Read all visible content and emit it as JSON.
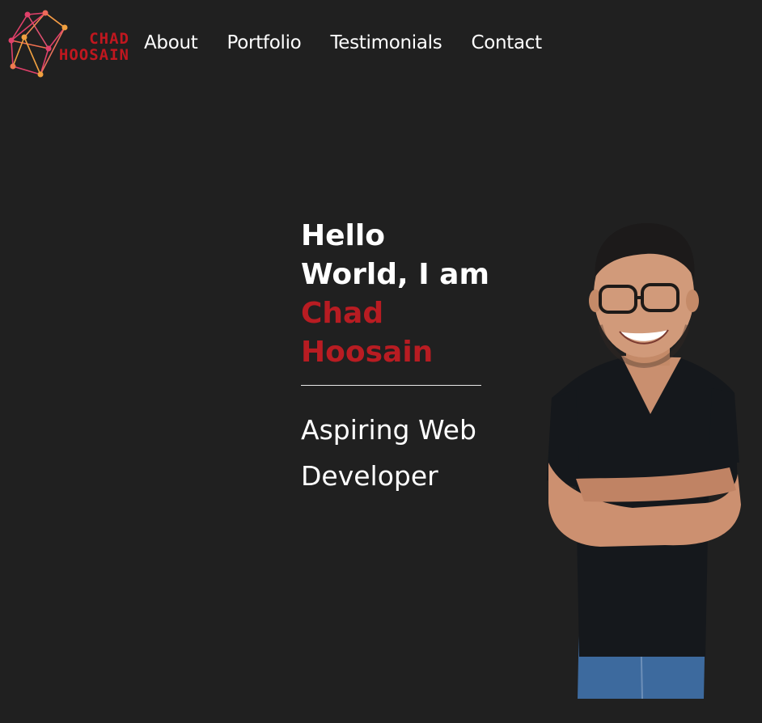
{
  "logo": {
    "line1": "CHAD",
    "line2": "HOOSAIN",
    "colors": {
      "text": "#c0171f",
      "network_pink": "#e0406a",
      "network_orange": "#f0a040"
    }
  },
  "nav": {
    "items": [
      {
        "label": "About"
      },
      {
        "label": "Portfolio"
      },
      {
        "label": "Testimonials"
      },
      {
        "label": "Contact"
      }
    ]
  },
  "hero": {
    "greeting_line1": "Hello",
    "greeting_line2": "World, I am",
    "name_line1": "Chad",
    "name_line2": "Hoosain",
    "subtitle": "Aspiring Web Developer",
    "name_color": "#b81c22"
  },
  "portrait": {
    "icon": "person-photo"
  },
  "theme": {
    "background": "#202020",
    "text": "#ffffff"
  }
}
